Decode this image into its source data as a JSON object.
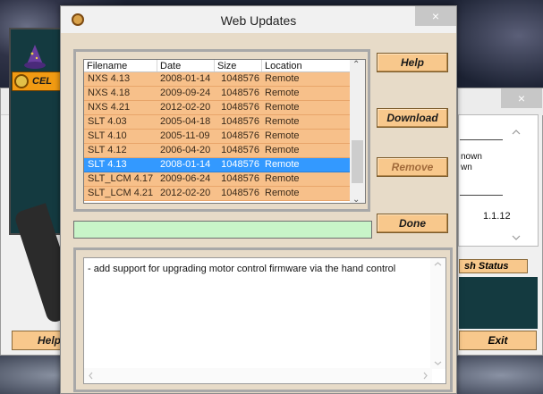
{
  "window": {
    "title": "Web Updates",
    "close_glyph": "×"
  },
  "file_list": {
    "columns": [
      "Filename",
      "Date",
      "Size",
      "Location"
    ],
    "rows": [
      {
        "filename": "NXS 4.13",
        "date": "2008-01-14",
        "size": "1048576",
        "location": "Remote"
      },
      {
        "filename": "NXS 4.18",
        "date": "2009-09-24",
        "size": "1048576",
        "location": "Remote"
      },
      {
        "filename": "NXS 4.21",
        "date": "2012-02-20",
        "size": "1048576",
        "location": "Remote"
      },
      {
        "filename": "SLT 4.03",
        "date": "2005-04-18",
        "size": "1048576",
        "location": "Remote"
      },
      {
        "filename": "SLT 4.10",
        "date": "2005-11-09",
        "size": "1048576",
        "location": "Remote"
      },
      {
        "filename": "SLT 4.12",
        "date": "2006-04-20",
        "size": "1048576",
        "location": "Remote"
      },
      {
        "filename": "SLT 4.13",
        "date": "2008-01-14",
        "size": "1048576",
        "location": "Remote",
        "selected": true
      },
      {
        "filename": "SLT_LCM 4.17",
        "date": "2009-06-24",
        "size": "1048576",
        "location": "Remote"
      },
      {
        "filename": "SLT_LCM 4.21",
        "date": "2012-02-20",
        "size": "1048576",
        "location": "Remote"
      }
    ]
  },
  "buttons": {
    "help": "Help",
    "download": "Download",
    "remove": "Remove",
    "done": "Done"
  },
  "progress": {
    "value": 0,
    "color": "#c8f4c8"
  },
  "description": {
    "text": "- add support for upgrading motor control firmware via the hand control"
  },
  "background_window": {
    "left": {
      "brand": "CEL",
      "help_label": "Help"
    },
    "right": {
      "line1": "nown",
      "line2": "wn",
      "version": "1.1.12",
      "status_label": "sh Status",
      "exit_label": "Exit"
    }
  },
  "colors": {
    "row_bg": "#f7c08a",
    "row_selected": "#3399ff",
    "button_bg": "#f8c88c",
    "window_bg": "#e7dbc8"
  }
}
